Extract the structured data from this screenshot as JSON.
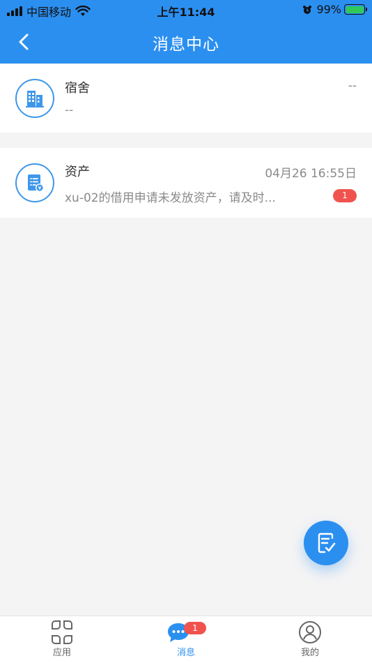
{
  "status_bar": {
    "carrier": "中国移动",
    "time": "上午11:44",
    "battery": "99%"
  },
  "header": {
    "title": "消息中心",
    "background_color": "#2b8ff0"
  },
  "messages": [
    {
      "title": "宿舍",
      "time": "--",
      "preview": "--",
      "icon": "building-icon"
    },
    {
      "title": "资产",
      "time": "04月26 16:55日",
      "preview": "xu-02的借用申请未发放资产，请及时...",
      "badge": "1",
      "icon": "asset-document-icon"
    }
  ],
  "fab": {
    "icon": "edit-checklist-icon"
  },
  "tabbar": {
    "tabs": [
      {
        "label": "应用",
        "icon": "apps-grid-icon",
        "active": false
      },
      {
        "label": "消息",
        "icon": "chat-bubble-icon",
        "active": true,
        "badge": "1"
      },
      {
        "label": "我的",
        "icon": "user-profile-icon",
        "active": false
      }
    ],
    "active_color": "#2b8ff0",
    "badge_color": "#f0534e"
  }
}
